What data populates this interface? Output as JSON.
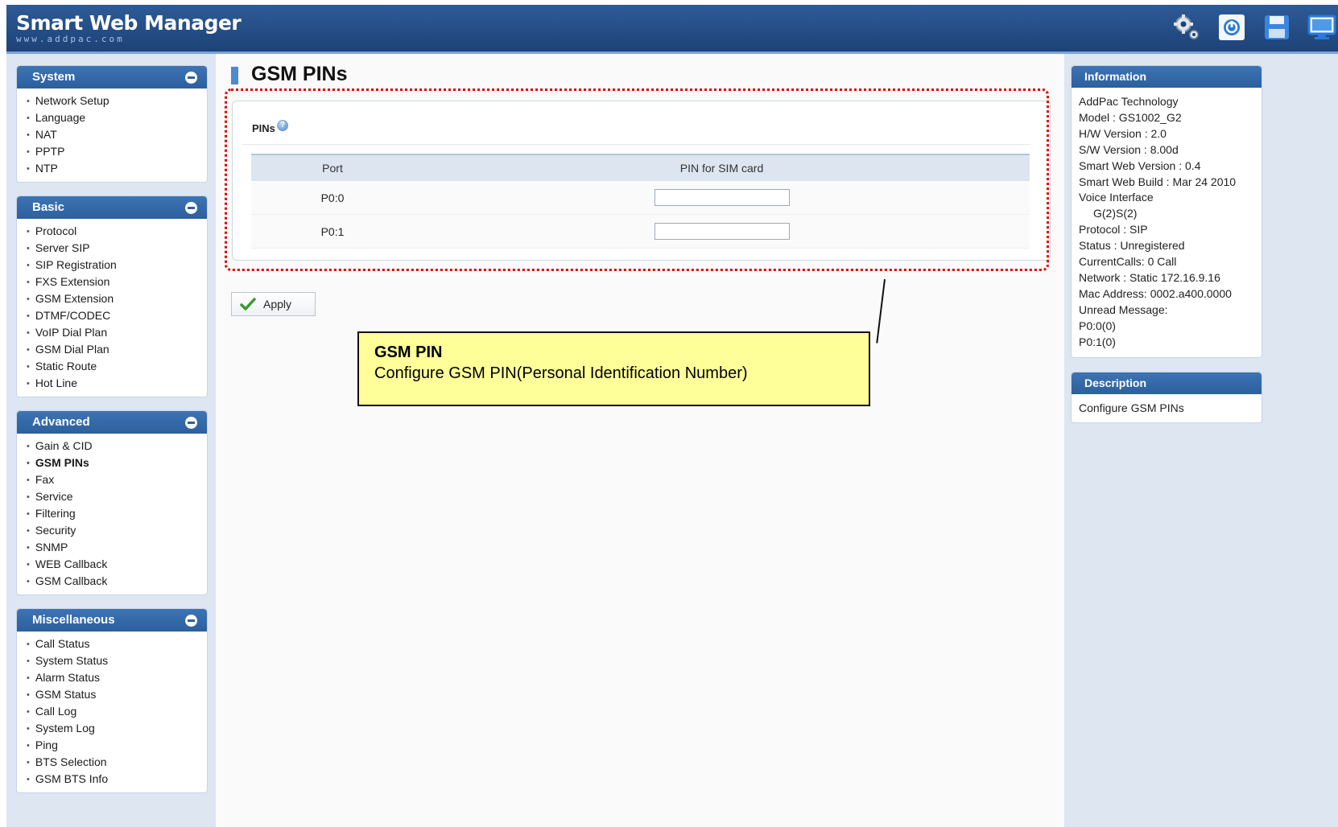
{
  "header": {
    "brand": "Smart Web Manager",
    "brand_sub": "www.addpac.com",
    "icons": [
      "settings-icon",
      "power-icon",
      "save-icon",
      "monitor-icon"
    ]
  },
  "sidebar": {
    "system": {
      "title": "System",
      "items": [
        "Network Setup",
        "Language",
        "NAT",
        "PPTP",
        "NTP"
      ]
    },
    "basic": {
      "title": "Basic",
      "items": [
        "Protocol",
        "Server SIP",
        "SIP Registration",
        "FXS Extension",
        "GSM Extension",
        "DTMF/CODEC",
        "VoIP Dial Plan",
        "GSM Dial Plan",
        "Static Route",
        "Hot Line"
      ]
    },
    "advanced": {
      "title": "Advanced",
      "items": [
        "Gain & CID",
        "GSM PINs",
        "Fax",
        "Service",
        "Filtering",
        "Security",
        "SNMP",
        "WEB Callback",
        "GSM Callback"
      ],
      "active": "GSM PINs"
    },
    "misc": {
      "title": "Miscellaneous",
      "items": [
        "Call Status",
        "System Status",
        "Alarm Status",
        "GSM Status",
        "Call Log",
        "System Log",
        "Ping",
        "BTS Selection",
        "GSM BTS Info"
      ]
    }
  },
  "main": {
    "title": "GSM PINs",
    "section_label": "PINs",
    "table": {
      "headers": [
        "Port",
        "PIN for SIM card"
      ],
      "rows": [
        {
          "port": "P0:0",
          "pin": ""
        },
        {
          "port": "P0:1",
          "pin": ""
        }
      ]
    },
    "apply_label": "Apply"
  },
  "callout": {
    "title": "GSM PIN",
    "body": "Configure GSM PIN(Personal Identification Number)"
  },
  "info": {
    "title": "Information",
    "lines": [
      "AddPac Technology",
      "Model : GS1002_G2",
      "H/W Version : 2.0",
      "S/W Version : 8.00d",
      "Smart Web Version : 0.4",
      "Smart Web Build : Mar 24 2010",
      "Voice Interface"
    ],
    "voice_interface": "G(2)S(2)",
    "lines2": [
      "Protocol : SIP",
      "Status : Unregistered",
      "CurrentCalls: 0 Call",
      "Network : Static 172.16.9.16",
      "Mac Address: 0002.a400.0000",
      "Unread Message:",
      "P0:0(0)",
      "P0:1(0)"
    ]
  },
  "description": {
    "title": "Description",
    "text": "Configure GSM PINs"
  },
  "colors": {
    "header": "#1d4278",
    "panel_head": "#2c5f9e",
    "callout_bg": "#ffff99",
    "highlight_border": "#e00000"
  }
}
